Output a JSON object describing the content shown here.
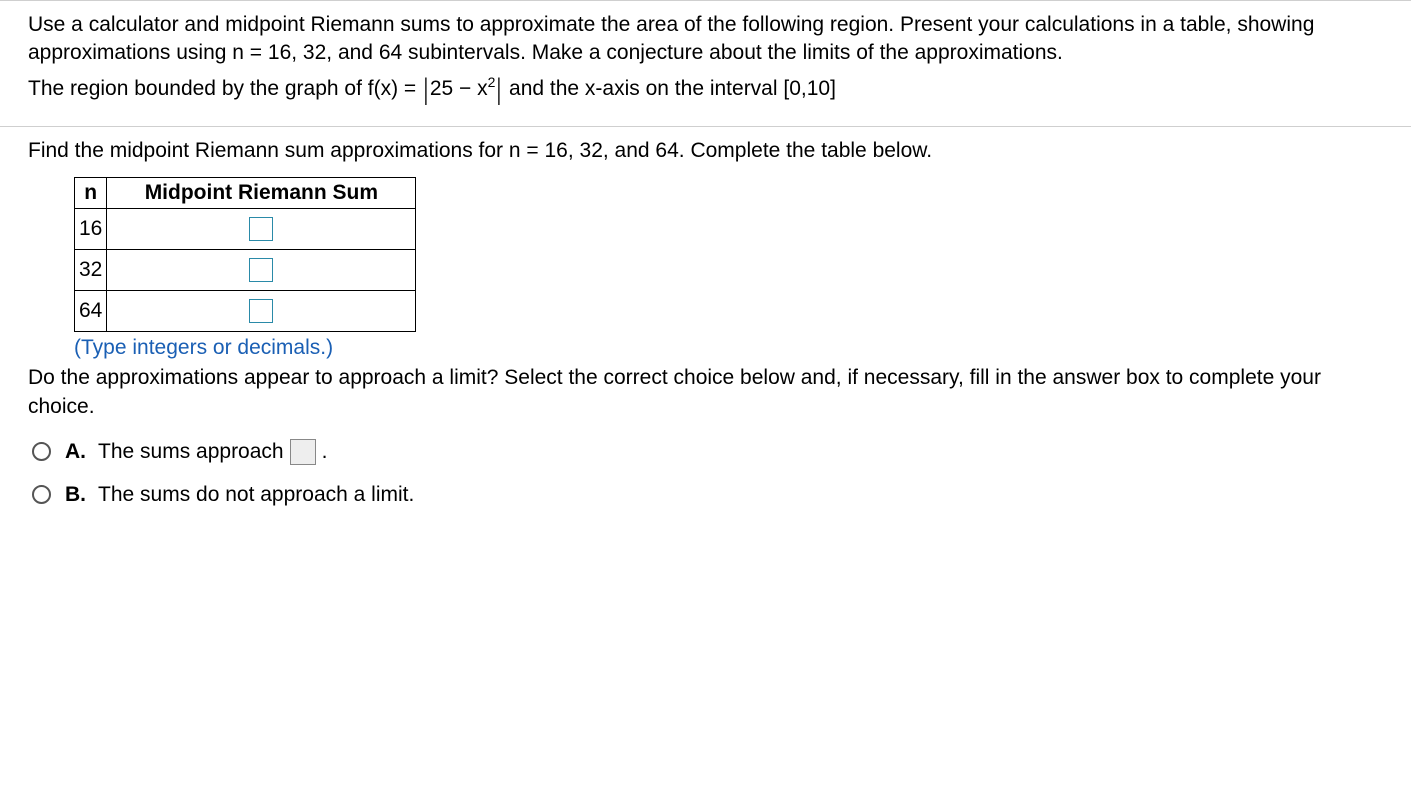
{
  "intro": {
    "para": "Use a calculator and midpoint Riemann sums to approximate the area of the following region. Present your calculations in a table, showing approximations using n = 16, 32, and 64 subintervals. Make a conjecture about the limits of the approximations.",
    "formula_prefix": "The region bounded by the graph of f(x) = ",
    "formula_inner_a": "25 − x",
    "formula_exp": "2",
    "formula_suffix": " and the x-axis on the interval [0,10]"
  },
  "question": {
    "prompt": "Find the midpoint Riemann sum approximations for n = 16, 32, and 64. Complete the table below.",
    "table": {
      "head_n": "n",
      "head_sum": "Midpoint Riemann Sum",
      "rows": [
        {
          "n": "16"
        },
        {
          "n": "32"
        },
        {
          "n": "64"
        }
      ]
    },
    "hint": "(Type integers or decimals.)",
    "followup": "Do the approximations appear to approach a limit? Select the correct choice below and, if necessary, fill in the answer box to complete your choice.",
    "choices": {
      "A": {
        "label": "A.",
        "text_before": "The sums approach",
        "text_after": "."
      },
      "B": {
        "label": "B.",
        "text": "The sums do not approach a limit."
      }
    }
  }
}
